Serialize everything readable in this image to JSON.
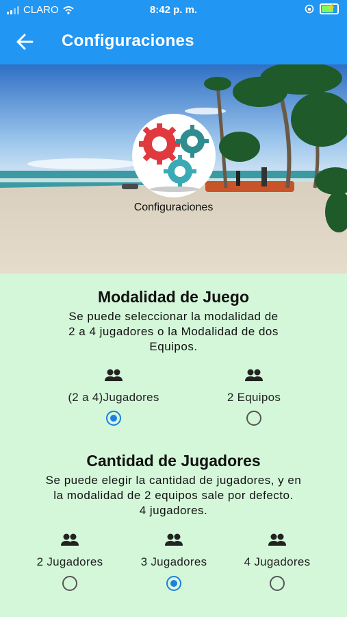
{
  "status": {
    "carrier": "CLARO",
    "time": "8:42 p. m."
  },
  "appbar": {
    "title": "Configuraciones"
  },
  "hero": {
    "logo_label": "Configuraciones"
  },
  "mode": {
    "title": "Modalidad de Juego",
    "desc_lines": [
      "Se puede seleccionar la modalidad de",
      "2 a 4 jugadores o la Modalidad de dos",
      "Equipos."
    ],
    "options": [
      {
        "label": "(2 a 4)Jugadores",
        "selected": true
      },
      {
        "label": "2 Equipos",
        "selected": false
      }
    ]
  },
  "players": {
    "title": "Cantidad de Jugadores",
    "desc_lines": [
      "Se puede elegir la cantidad de jugadores, y en",
      "la modalidad de 2 equipos sale por defecto.",
      "4 jugadores."
    ],
    "options": [
      {
        "label": "2 Jugadores",
        "selected": false
      },
      {
        "label": "3 Jugadores",
        "selected": true
      },
      {
        "label": "4 Jugadores",
        "selected": false
      }
    ]
  },
  "colors": {
    "appbar": "#2196f3",
    "background": "#d4f7d9",
    "radio_selected": "#1e7fe0"
  }
}
